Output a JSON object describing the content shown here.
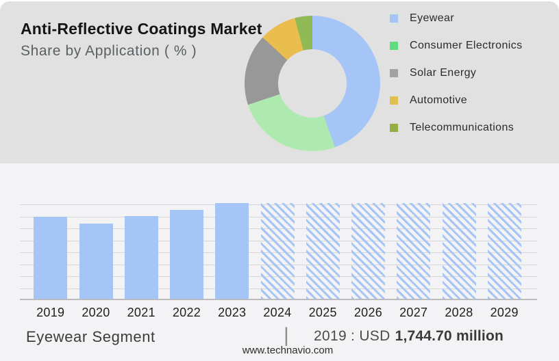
{
  "header": {
    "title": "Anti-Reflective Coatings Market",
    "subtitle": "Share by Application ( % )"
  },
  "chart_data": [
    {
      "type": "pie",
      "donut": true,
      "title": "Anti-Reflective Coatings Market",
      "subtitle": "Share by Application ( % )",
      "labels": [
        "Eyewear",
        "Consumer Electronics",
        "Solar Energy",
        "Automotive",
        "Telecommunications"
      ],
      "values_pct_est": [
        44.6,
        25.3,
        17.0,
        8.9,
        4.2
      ],
      "colors": [
        "#a6c5f7",
        "#aee9b0",
        "#989898",
        "#e9bd4e",
        "#8fba55"
      ],
      "legend_colors": [
        "#a6c5f7",
        "#5edd80",
        "#a2a2a2",
        "#e0c14f",
        "#92b044"
      ],
      "legend_position": "right"
    },
    {
      "type": "bar",
      "categories": [
        "2019",
        "2020",
        "2021",
        "2022",
        "2023",
        "2024",
        "2025",
        "2026",
        "2027",
        "2028",
        "2029"
      ],
      "values_rel": [
        120,
        110,
        121,
        130,
        140,
        140,
        140,
        140,
        140,
        140,
        140
      ],
      "ylim": [
        0,
        140
      ],
      "bar_style": [
        "solid",
        "solid",
        "solid",
        "solid",
        "solid",
        "hatched",
        "hatched",
        "hatched",
        "hatched",
        "hatched",
        "hatched"
      ],
      "bar_color": "#a6c5f7",
      "grid": true,
      "gridline_count": 8,
      "annotation": "Eyewear Segment | 2019 : USD 1,744.70 million",
      "value_2019_usd_million": "1,744.70"
    }
  ],
  "footer": {
    "segment_label": "Eyewear Segment",
    "divider": "|",
    "value_prefix": "2019 : USD",
    "value_bold": "1,744.70 million",
    "website": "www.technavio.com"
  }
}
